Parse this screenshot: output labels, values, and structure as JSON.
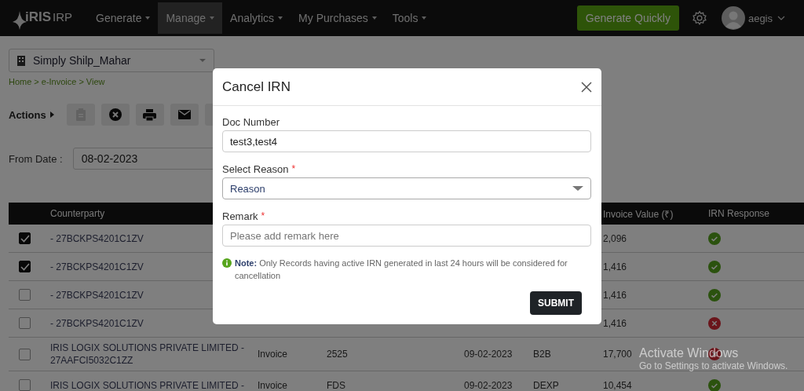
{
  "nav": {
    "logo": "iRIS",
    "logo_suffix": "IRP",
    "menus": [
      {
        "label": "Generate",
        "selected": false
      },
      {
        "label": "Manage",
        "selected": true
      },
      {
        "label": "Analytics",
        "selected": false
      },
      {
        "label": "My Purchases",
        "selected": false
      },
      {
        "label": "Tools",
        "selected": false
      }
    ],
    "quick_button": "Generate Quickly",
    "user": "aegis"
  },
  "company_select": "Simply Shilp_Mahar",
  "breadcrumb": {
    "items": [
      "Home",
      "e-Invoice",
      "View"
    ],
    "separator": ">"
  },
  "actions": {
    "label": "Actions",
    "tools": [
      {
        "kind": "clipboard",
        "disabled": true
      },
      {
        "kind": "cancel",
        "disabled": false
      },
      {
        "kind": "print",
        "disabled": false
      },
      {
        "kind": "mail",
        "disabled": false
      }
    ]
  },
  "from_date": {
    "label": "From Date :",
    "value": "08-02-2023"
  },
  "table": {
    "columns": [
      "Counterparty",
      "Invoice Value (₹)",
      "IRN Response"
    ],
    "rows": [
      {
        "checked": true,
        "counterparty": "- 27BCKPS4201C1ZV",
        "invoice_value": "2,096",
        "irn_success": true
      },
      {
        "checked": true,
        "counterparty": "- 27BCKPS4201C1ZV",
        "invoice_value": "1,416",
        "irn_success": true
      },
      {
        "checked": false,
        "counterparty": "- 27BCKPS4201C1ZV",
        "invoice_value": "1,416",
        "irn_success": true
      },
      {
        "checked": false,
        "counterparty": "- 27BCKPS4201C1ZV",
        "invoice_value": "1,416",
        "irn_success": false
      },
      {
        "checked": false,
        "counterparty": "IRIS LOGIX SOLUTIONS PRIVATE LIMITED - 27AAFCI5032C1ZZ",
        "column_3": "Invoice",
        "column_4": "2525",
        "column_5": "09-02-2023",
        "column_6": "B2B",
        "invoice_value": "17,700",
        "irn_success": false
      },
      {
        "checked": false,
        "counterparty": "IRIS LOGIX SOLUTIONS PRIVATE LIMITED -",
        "column_3": "Invoice",
        "column_4": "FDS",
        "column_5": "09-02-2023",
        "column_6": "DEXP",
        "invoice_value": "10,454",
        "irn_success": true
      }
    ]
  },
  "modal": {
    "title": "Cancel IRN",
    "doc_number": {
      "label": "Doc Number",
      "value": "test3,test4"
    },
    "reason": {
      "label": "Select Reason",
      "required_mark": "*",
      "value": "Reason"
    },
    "remark": {
      "label": "Remark",
      "required_mark": "*",
      "placeholder": "Please add remark here"
    },
    "note": "**Note:** Only Records having active IRN generated in last 24 hours will be considered for cancellation",
    "submit": "SUBMIT"
  },
  "os_watermark": {
    "title": "Activate Windows",
    "subtitle": "Go to Settings to activate Windows."
  }
}
